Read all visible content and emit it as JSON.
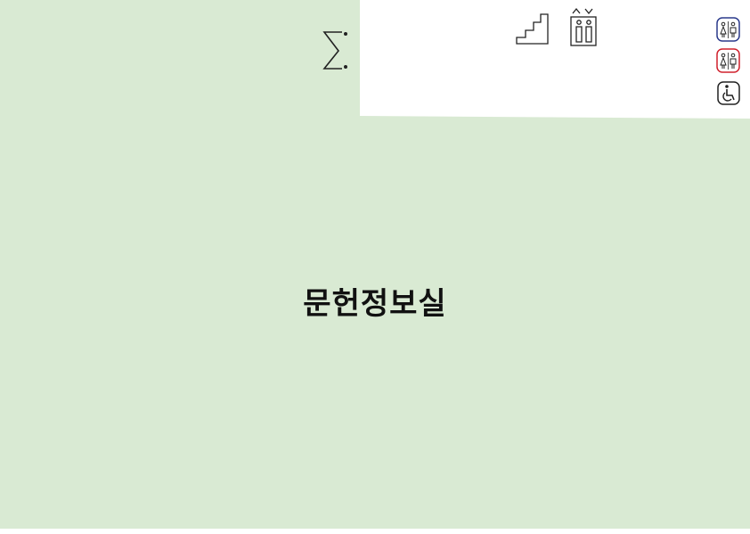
{
  "floor_plan": {
    "room_label": "문헌정보실",
    "room_color": "#d9ead3"
  },
  "icons": {
    "stairs": "stairs-icon",
    "elevator": "elevator-icon",
    "restroom_male": "restroom-icon",
    "restroom_female": "restroom-icon",
    "accessible": "wheelchair-icon",
    "shelf": "shelf-icon"
  },
  "colors": {
    "male_outline": "#2b3a8c",
    "female_outline": "#d0212d"
  }
}
